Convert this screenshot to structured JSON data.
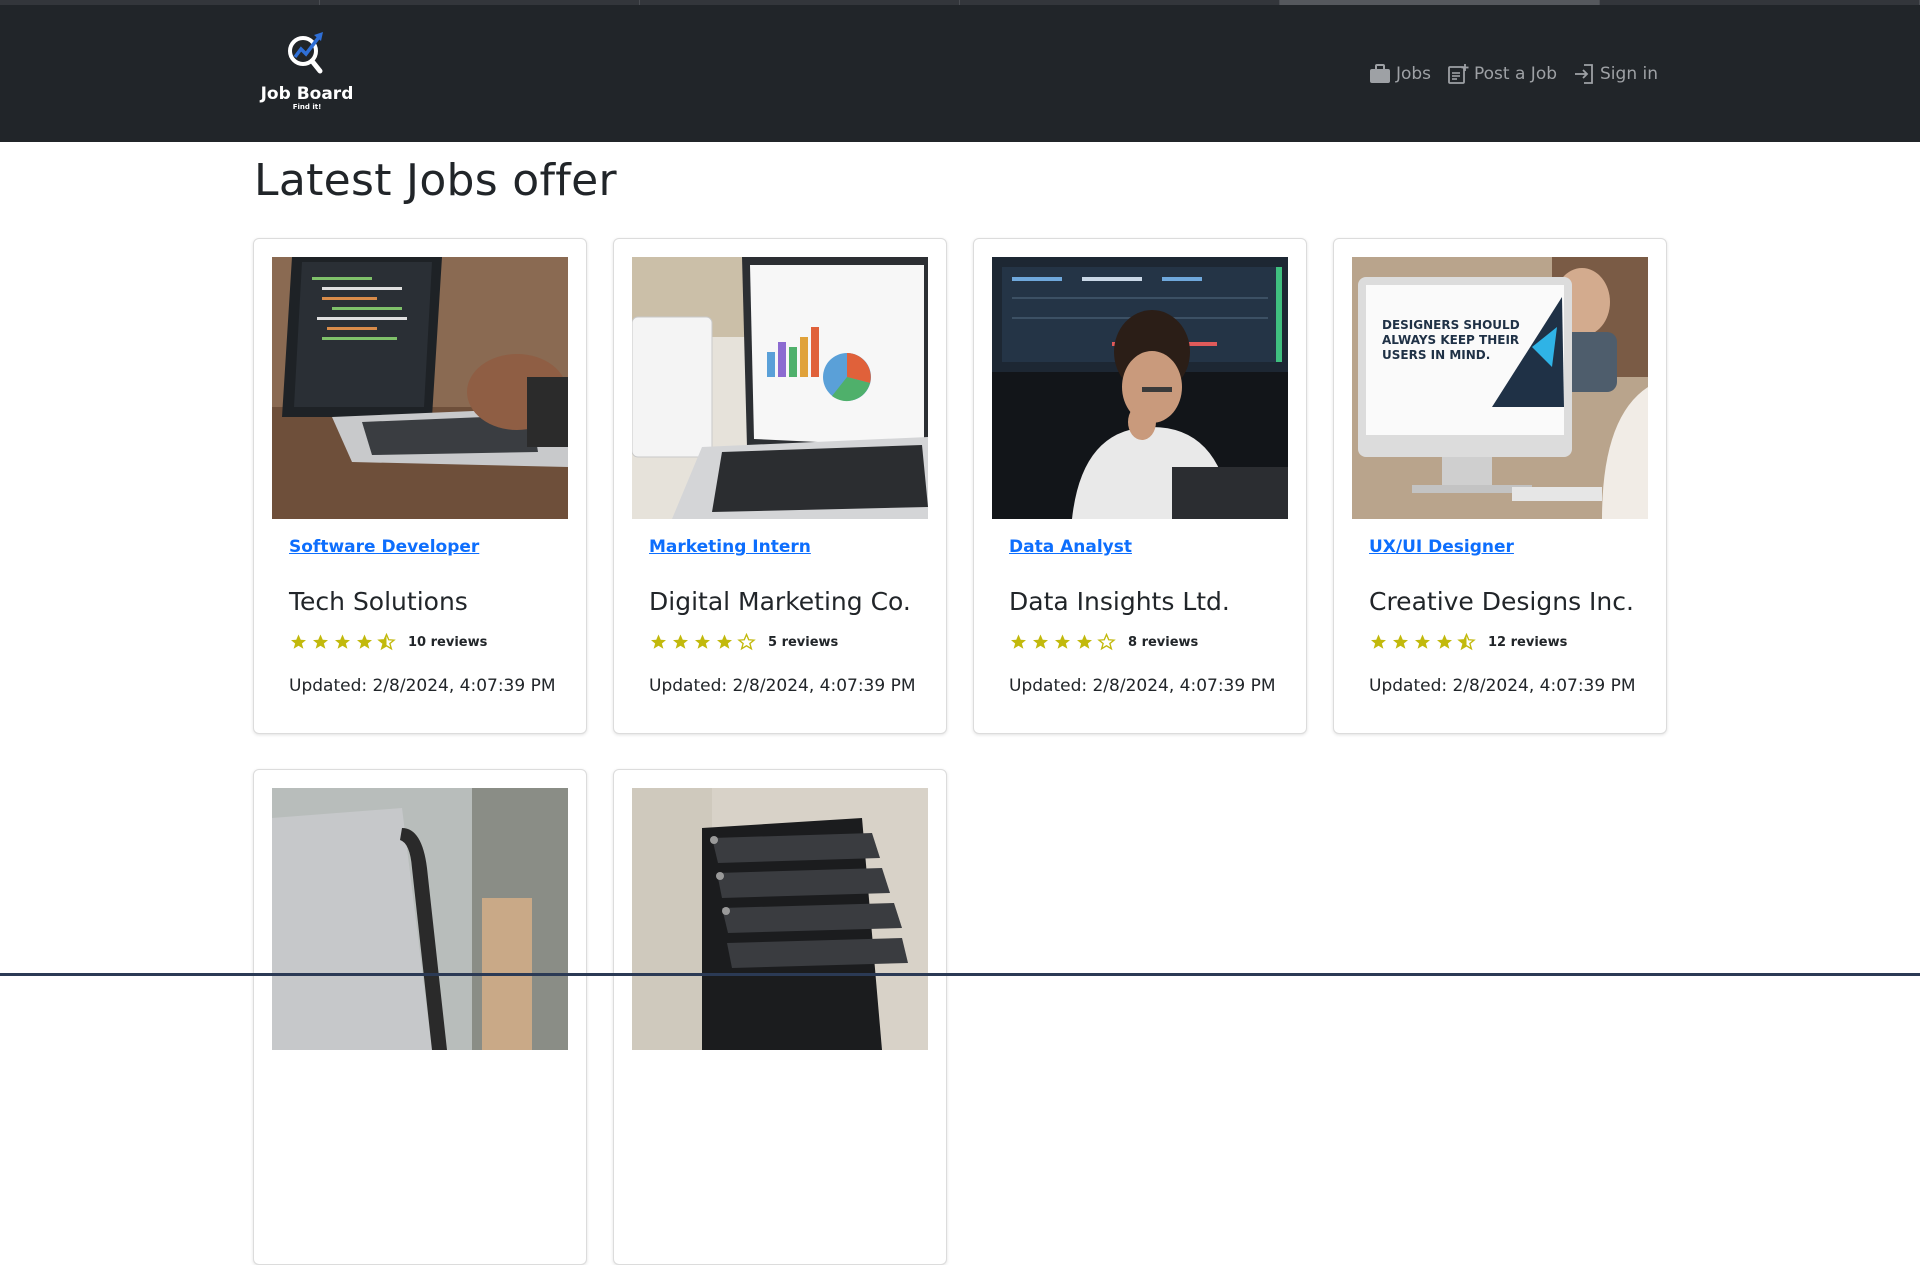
{
  "brand": {
    "name": "Job Board",
    "tagline": "Find it!"
  },
  "nav": {
    "jobs": "Jobs",
    "post_job": "Post a Job",
    "sign_in": "Sign in"
  },
  "page": {
    "heading": "Latest Jobs offer"
  },
  "cards": [
    {
      "title": "Software Developer",
      "company": "Tech Solutions",
      "rating": 4.5,
      "reviews": "10 reviews",
      "updated": "Updated: 2/8/2024, 4:07:39 PM",
      "image": "laptop-code-photo"
    },
    {
      "title": "Marketing Intern",
      "company": "Digital Marketing Co.",
      "rating": 4,
      "reviews": "5 reviews",
      "updated": "Updated: 2/8/2024, 4:07:39 PM",
      "image": "laptop-charts-photo"
    },
    {
      "title": "Data Analyst",
      "company": "Data Insights Ltd.",
      "rating": 4,
      "reviews": "8 reviews",
      "updated": "Updated: 2/8/2024, 4:07:39 PM",
      "image": "analyst-screens-photo"
    },
    {
      "title": "UX/UI Designer",
      "company": "Creative Designs Inc.",
      "rating": 4.5,
      "reviews": "12 reviews",
      "updated": "Updated: 2/8/2024, 4:07:39 PM",
      "image": "designer-monitor-photo",
      "image_text": "DESIGNERS SHOULD ALWAYS KEEP THEIR USERS IN MIND."
    },
    {
      "image": "laptop-bag-photo"
    },
    {
      "image": "binders-photo"
    }
  ],
  "colors": {
    "navbar": "#212529",
    "link": "#0d6efd",
    "star": "#c2b90c"
  }
}
